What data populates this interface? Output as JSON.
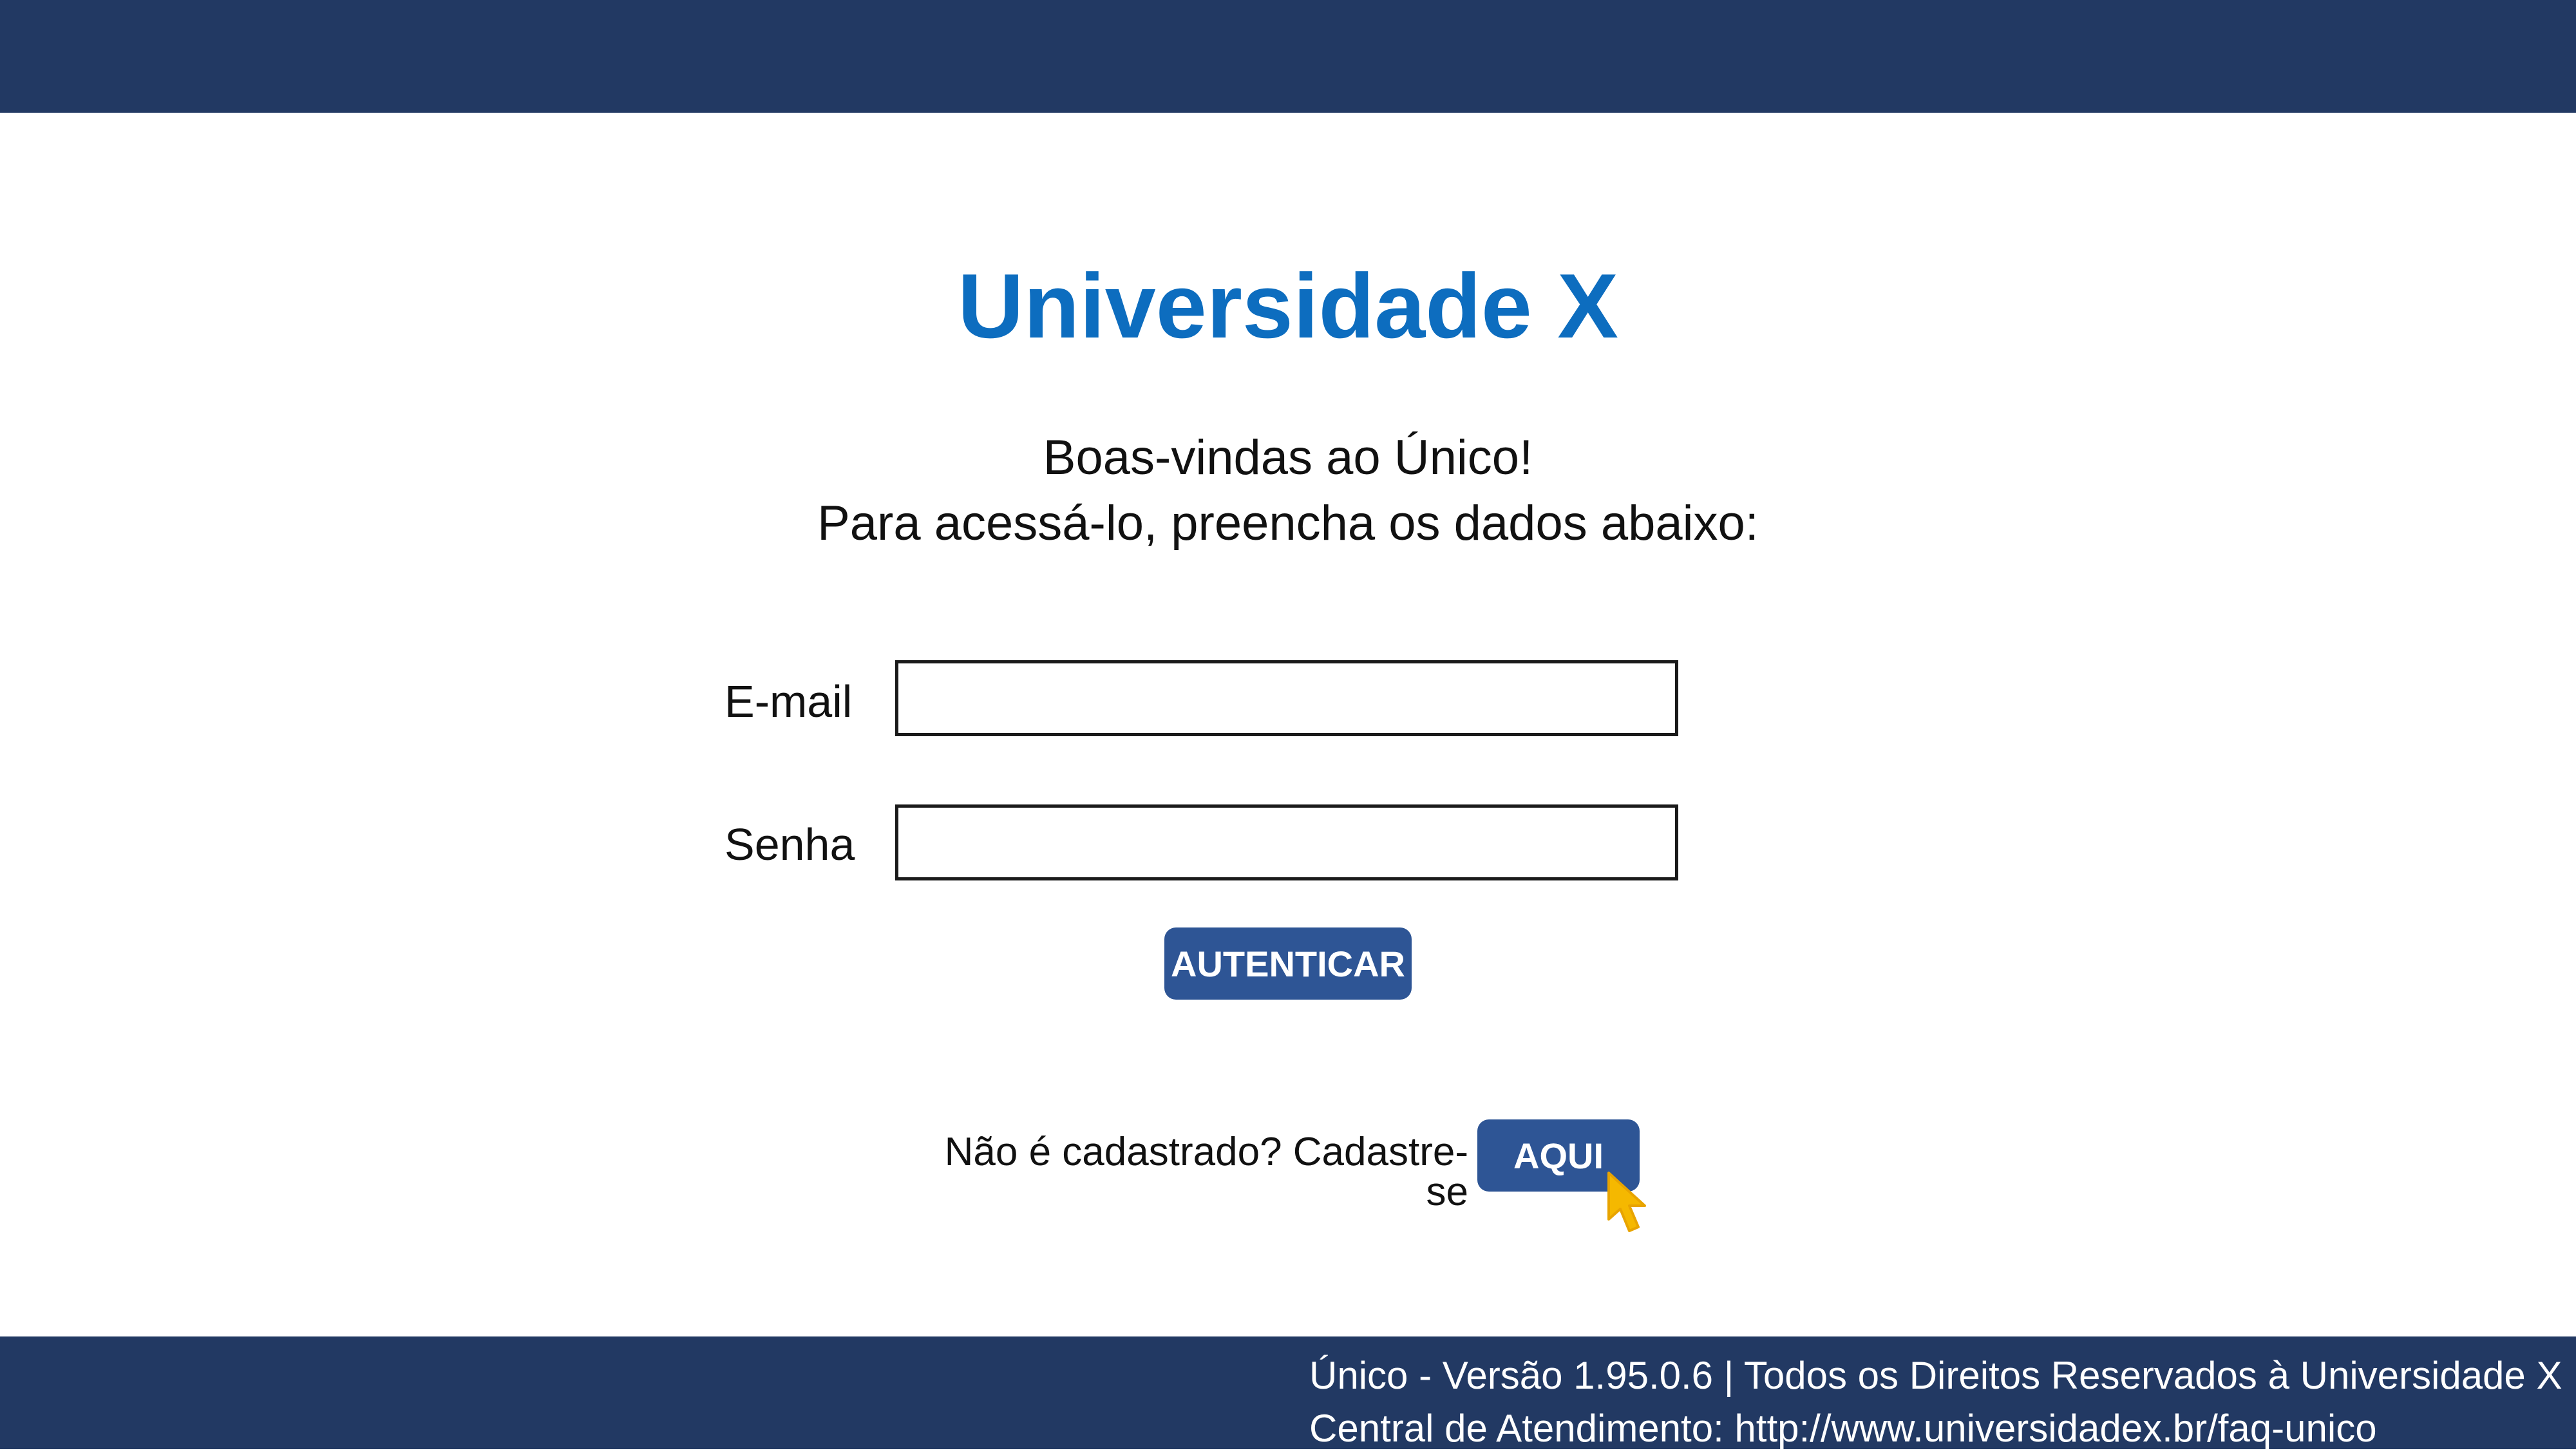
{
  "header": {
    "bar_color": "#223963"
  },
  "brand": {
    "title": "Universidade X",
    "color": "#0d6dbf"
  },
  "welcome": {
    "line1": "Boas-vindas ao Único!",
    "line2": "Para acessá-lo, preencha os dados abaixo:"
  },
  "form": {
    "email": {
      "label": "E-mail",
      "value": "",
      "placeholder": ""
    },
    "password": {
      "label": "Senha",
      "value": "",
      "placeholder": ""
    },
    "submit_label": "AUTENTICAR",
    "button_color": "#2e5595"
  },
  "register": {
    "text": "Não é cadastrado? Cadastre-se",
    "button_label": "AQUI",
    "cursor_icon": "pointer-cursor-icon",
    "cursor_color": "#f5b800"
  },
  "footer": {
    "line1": "Único - Versão 1.95.0.6 | Todos os Direitos Reservados à Universidade X",
    "line2": "Central de Atendimento: http://www.universidadex.br/faq-unico",
    "bar_color": "#223963"
  }
}
